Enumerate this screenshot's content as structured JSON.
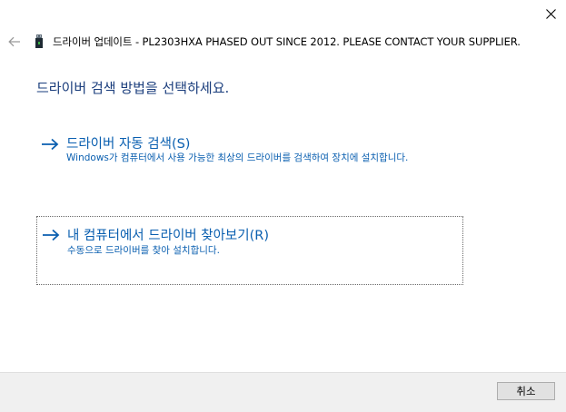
{
  "window": {
    "close_icon": "close-icon"
  },
  "titlebar": {
    "back_icon": "back-arrow-icon",
    "device_icon": "usb-device-icon",
    "title": "드라이버 업데이트 - PL2303HXA PHASED OUT SINCE 2012. PLEASE CONTACT YOUR SUPPLIER."
  },
  "main": {
    "heading": "드라이버 검색 방법을 선택하세요.",
    "options": [
      {
        "icon": "arrow-right-icon",
        "title": "드라이버 자동 검색(S)",
        "description": "Windows가 컴퓨터에서 사용 가능한 최상의 드라이버를 검색하여 장치에 설치합니다."
      },
      {
        "icon": "arrow-right-icon",
        "title": "내 컴퓨터에서 드라이버 찾아보기(R)",
        "description": "수동으로 드라이버를 찾아 설치합니다."
      }
    ]
  },
  "footer": {
    "cancel_label": "취소"
  },
  "colors": {
    "heading": "#1a3d7c",
    "link": "#0a5fb0",
    "footer_bg": "#f0f0f0",
    "button_bg": "#e1e1e1"
  }
}
